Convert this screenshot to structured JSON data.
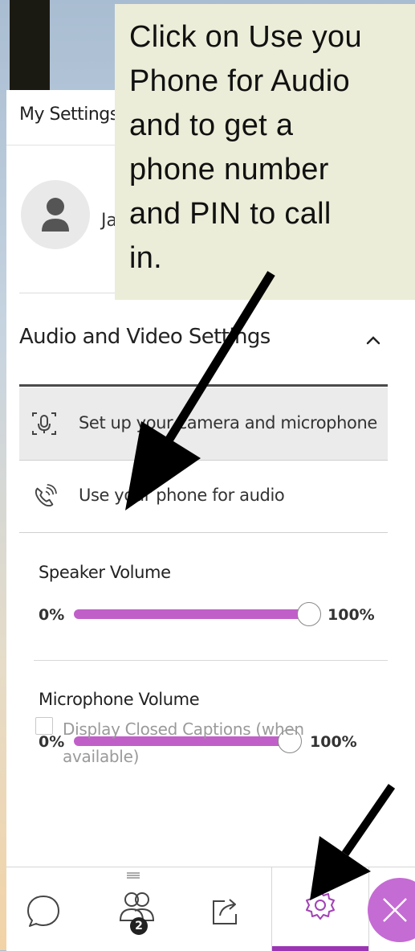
{
  "panel": {
    "title": "My Settings",
    "user_initial": "Ja"
  },
  "audio_video": {
    "section_title": "Audio and Video Settings",
    "items": [
      {
        "label": "Set up your camera and microphone",
        "icon": "camera-microphone-icon"
      },
      {
        "label": "Use your phone for audio",
        "icon": "phone-icon"
      }
    ],
    "speaker": {
      "label": "Speaker Volume",
      "min": "0%",
      "max": "100%",
      "level": 1.0
    },
    "microphone": {
      "label": "Microphone Volume",
      "min": "0%",
      "max": "100%",
      "level": 1.0
    }
  },
  "captions": {
    "label": "Display Closed Captions (when available)",
    "checked": false
  },
  "toolbar": {
    "items": [
      "chat-icon",
      "participants-icon",
      "share-icon",
      "gear-icon"
    ],
    "participants_badge": "2",
    "active": "gear-icon"
  },
  "callout": {
    "lines": [
      "Click on Use you",
      "Phone for Audio",
      "and to get a",
      "phone number",
      "and PIN to call",
      "in."
    ]
  },
  "colors": {
    "accent": "#c15fc9",
    "active_tab": "#9b35b4",
    "callout_bg": "#ecedd8"
  }
}
